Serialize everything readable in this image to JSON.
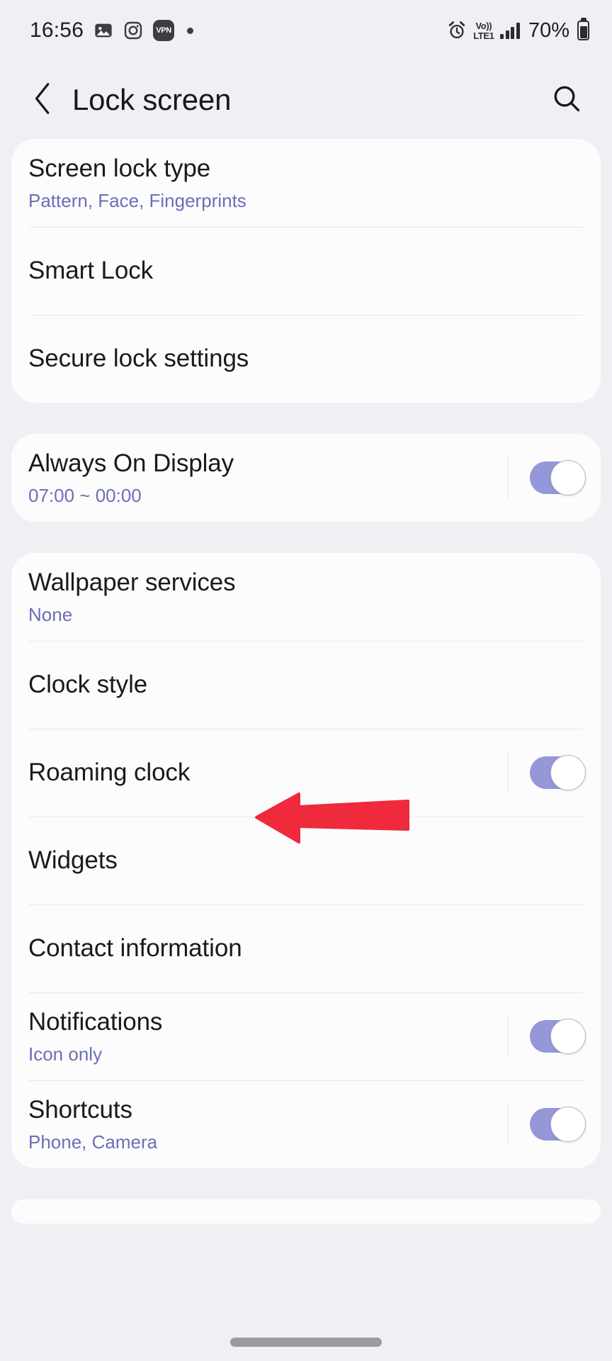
{
  "status_bar": {
    "time": "16:56",
    "left_icons": [
      "gallery-icon",
      "instagram-icon",
      "vpn-badge",
      "status-dot"
    ],
    "vpn_label": "VPN",
    "right_icons": [
      "alarm-icon",
      "volte-icon",
      "signal-bars-icon",
      "battery-icon"
    ],
    "volte_line1": "Vo))",
    "volte_line2": "LTE1",
    "battery_percent": "70%"
  },
  "app_bar": {
    "title": "Lock screen",
    "back_icon": "chevron-left-icon",
    "search_icon": "search-icon"
  },
  "colors": {
    "page_background": "#f0eff4",
    "card_background": "#fcfcfd",
    "title_text": "#1a1a1d",
    "subtitle_accent": "#6b6fb5",
    "toggle_on_track": "#9498d8",
    "annotation_arrow": "#ee2a3c",
    "divider": "#e9e9ee"
  },
  "cards": [
    {
      "rows": [
        {
          "title": "Screen lock type",
          "subtitle": "Pattern, Face, Fingerprints",
          "toggle": null
        },
        {
          "title": "Smart Lock",
          "subtitle": "",
          "toggle": null
        },
        {
          "title": "Secure lock settings",
          "subtitle": "",
          "toggle": null
        }
      ]
    },
    {
      "rows": [
        {
          "title": "Always On Display",
          "subtitle": "07:00 ~ 00:00",
          "toggle": "on"
        }
      ]
    },
    {
      "rows": [
        {
          "title": "Wallpaper services",
          "subtitle": "None",
          "toggle": null
        },
        {
          "title": "Clock style",
          "subtitle": "",
          "toggle": null
        },
        {
          "title": "Roaming clock",
          "subtitle": "",
          "toggle": "on"
        },
        {
          "title": "Widgets",
          "subtitle": "",
          "toggle": null
        },
        {
          "title": "Contact information",
          "subtitle": "",
          "toggle": null
        },
        {
          "title": "Notifications",
          "subtitle": "Icon only",
          "toggle": "on"
        },
        {
          "title": "Shortcuts",
          "subtitle": "Phone, Camera",
          "toggle": "on"
        }
      ]
    }
  ],
  "annotation": {
    "type": "arrow",
    "direction": "left",
    "color": "#ee2a3c",
    "points_at": "Wallpaper services"
  },
  "navigation": {
    "home_indicator": "home-gesture-bar"
  }
}
